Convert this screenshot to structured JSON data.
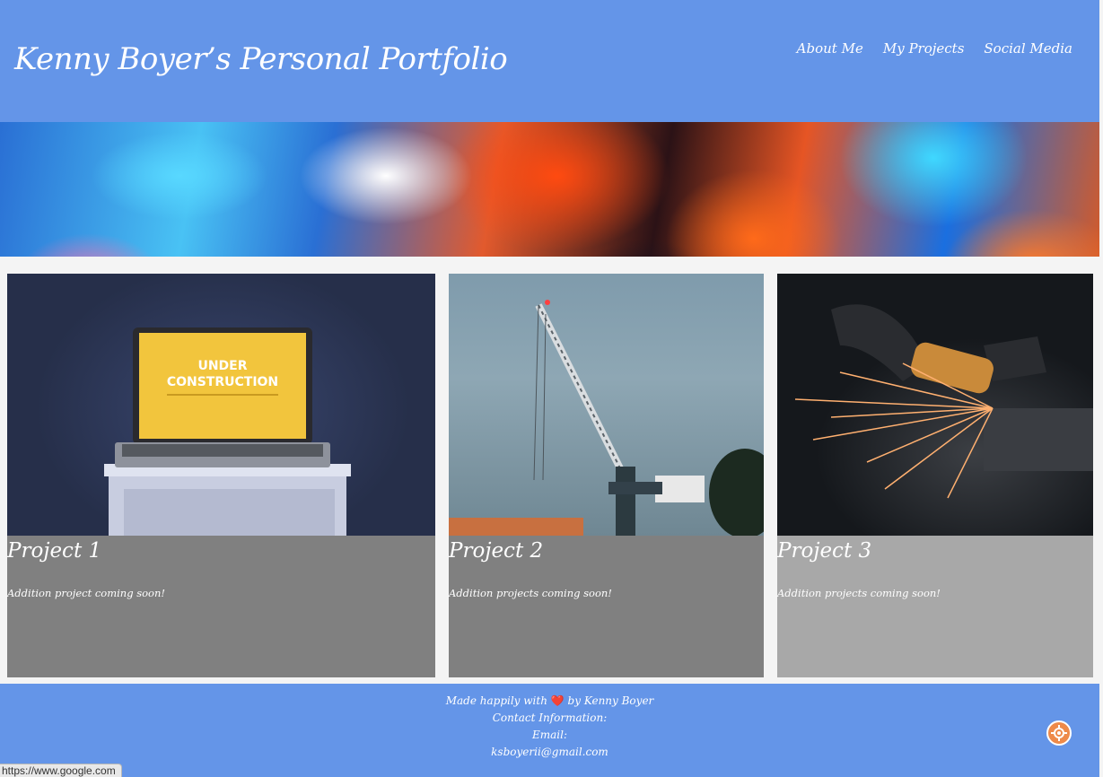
{
  "header": {
    "title": "Kenny Boyer’s Personal Portfolio",
    "nav": [
      "About Me",
      "My Projects",
      "Social Media"
    ]
  },
  "projects": [
    {
      "title": "Project 1",
      "text": "Addition project coming soon!",
      "image": "laptop-under-construction-image",
      "image_text": [
        "UNDER",
        "CONSTRUCTION"
      ]
    },
    {
      "title": "Project 2",
      "text": "Addition projects coming soon!",
      "image": "crane-image"
    },
    {
      "title": "Project 3",
      "text": "Addition projects coming soon!",
      "image": "grinder-sparks-image"
    }
  ],
  "footer": {
    "made_before": "Made happily with",
    "made_after": "by Kenny Boyer",
    "heart": "❤️",
    "contact": "Contact Information:",
    "email_label": "Email:",
    "email": "ksboyerii@gmail.com"
  },
  "status_bar": {
    "url": "https://www.google.com"
  },
  "colors": {
    "header_bg": "#6495e8",
    "card_body": "#808080",
    "card_body_alt": "#a8a8a8",
    "page_bg": "#f4f4f4"
  }
}
